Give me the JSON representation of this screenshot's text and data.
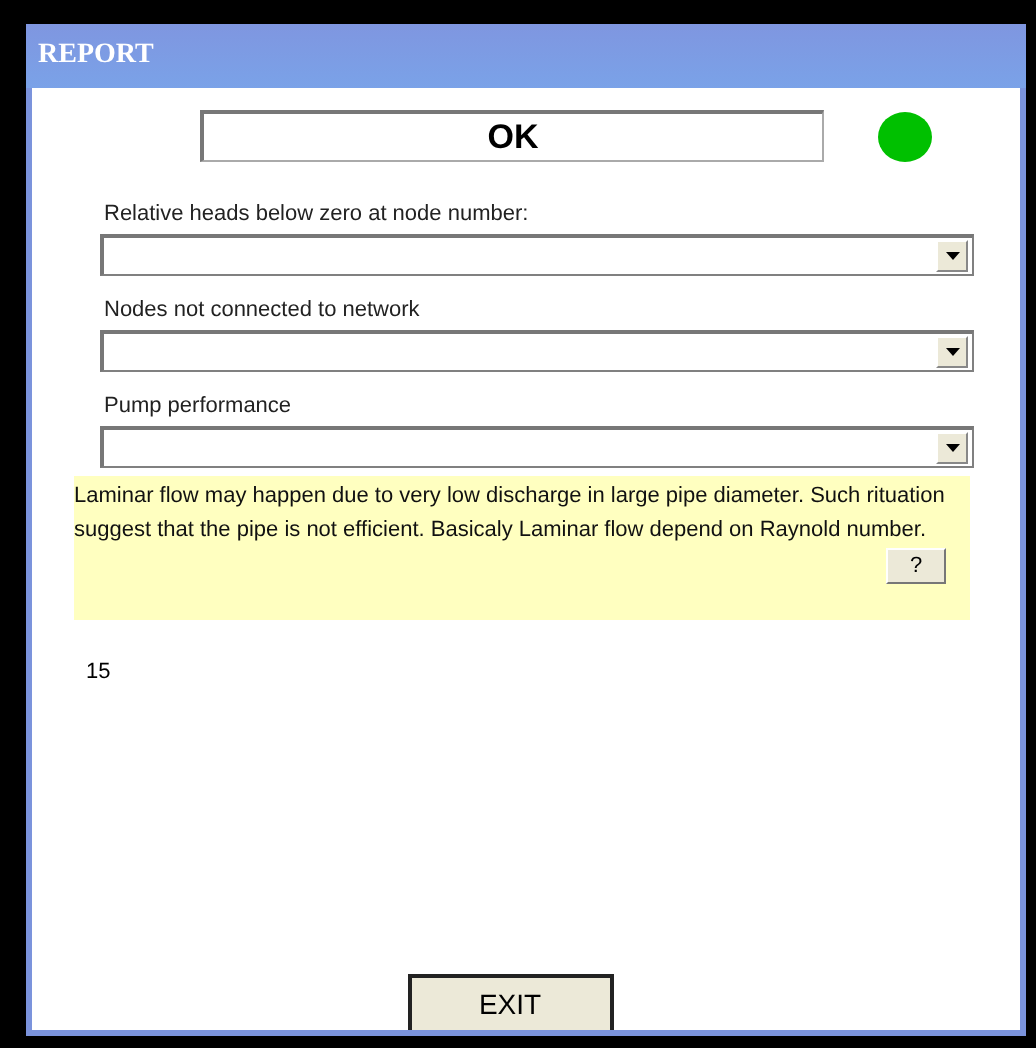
{
  "window": {
    "title": "REPORT"
  },
  "status": {
    "text": "OK",
    "color": "#00c000"
  },
  "dropdowns": [
    {
      "label": "Relative heads below zero at node number:"
    },
    {
      "label": "Nodes not connected to network"
    },
    {
      "label": "Pump performance"
    }
  ],
  "note": {
    "text": "Laminar flow may happen due to very low discharge in large pipe diameter. Such rituation suggest that the pipe is not efficient. Basicaly Laminar flow depend on Raynold number.",
    "help_button": "?"
  },
  "count": "15",
  "buttons": [
    "EXIT"
  ]
}
